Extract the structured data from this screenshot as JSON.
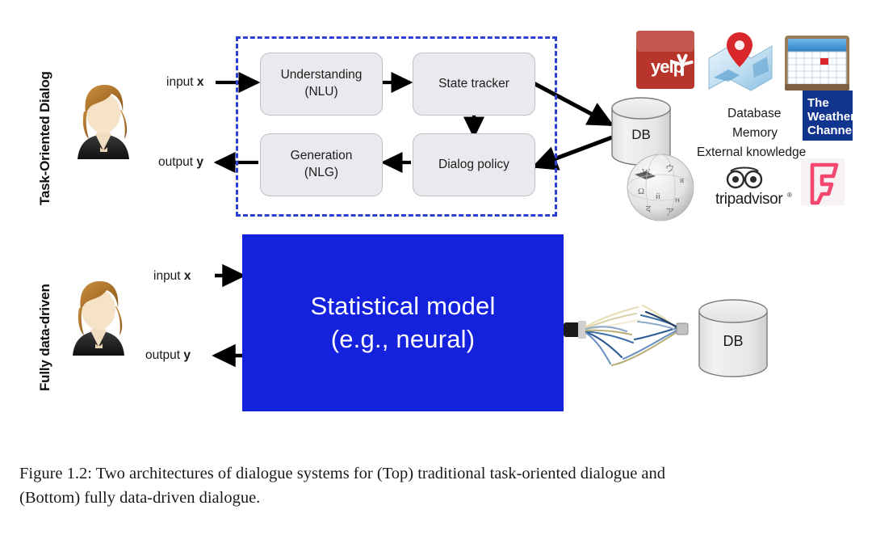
{
  "figure": {
    "row_labels": {
      "top": "Task-Oriented Dialog",
      "bottom": "Fully data-driven"
    },
    "top_pipeline": {
      "io": {
        "input_prefix": "input ",
        "input_symbol": "x",
        "output_prefix": "output ",
        "output_symbol": "y"
      },
      "modules": [
        {
          "id": "nlu",
          "line1": "Understanding",
          "line2": "(NLU)"
        },
        {
          "id": "state-tracker",
          "line1": "State tracker",
          "line2": ""
        },
        {
          "id": "dialog-policy",
          "line1": "Dialog policy",
          "line2": ""
        },
        {
          "id": "nlg",
          "line1": "Generation",
          "line2": "(NLG)"
        }
      ],
      "database_label": "DB",
      "knowledge_text": [
        "Database",
        "Memory",
        "External knowledge"
      ],
      "logos": [
        {
          "id": "yelp",
          "label": "yelp"
        },
        {
          "id": "maps",
          "label": "maps-pin"
        },
        {
          "id": "calendar",
          "label": "calendar"
        },
        {
          "id": "weather-channel",
          "label": "The Weather Channel"
        },
        {
          "id": "wikipedia",
          "label": "Wikipedia"
        },
        {
          "id": "tripadvisor",
          "label": "tripadvisor"
        },
        {
          "id": "foursquare",
          "label": "Foursquare"
        }
      ],
      "weather_channel_lines": [
        "The",
        "Weather",
        "Channel"
      ],
      "tripadvisor_label": "tripadvisor",
      "tripadvisor_mark": "®",
      "yelp_label": "yelp"
    },
    "bottom_pipeline": {
      "io": {
        "input_prefix": "input ",
        "input_symbol": "x",
        "output_prefix": "output ",
        "output_symbol": "y"
      },
      "model_line1": "Statistical model",
      "model_line2": "(e.g., neural)",
      "database_label": "DB"
    },
    "caption": {
      "line1": "Figure 1.2: Two architectures of dialogue systems for (Top) traditional task-oriented dialogue and",
      "line2": "(Bottom) fully data-driven dialogue."
    },
    "colors": {
      "dashed_border": "#2f3fd6",
      "model_blue": "#1421dd",
      "module_fill": "#eaeaee",
      "module_stroke": "#bfbfcc",
      "arrow": "#000000",
      "yelp_red": "#b8352c",
      "weather_blue": "#11358e",
      "foursquare_pink": "#f3476f",
      "page_bg": "#ffffff"
    }
  }
}
